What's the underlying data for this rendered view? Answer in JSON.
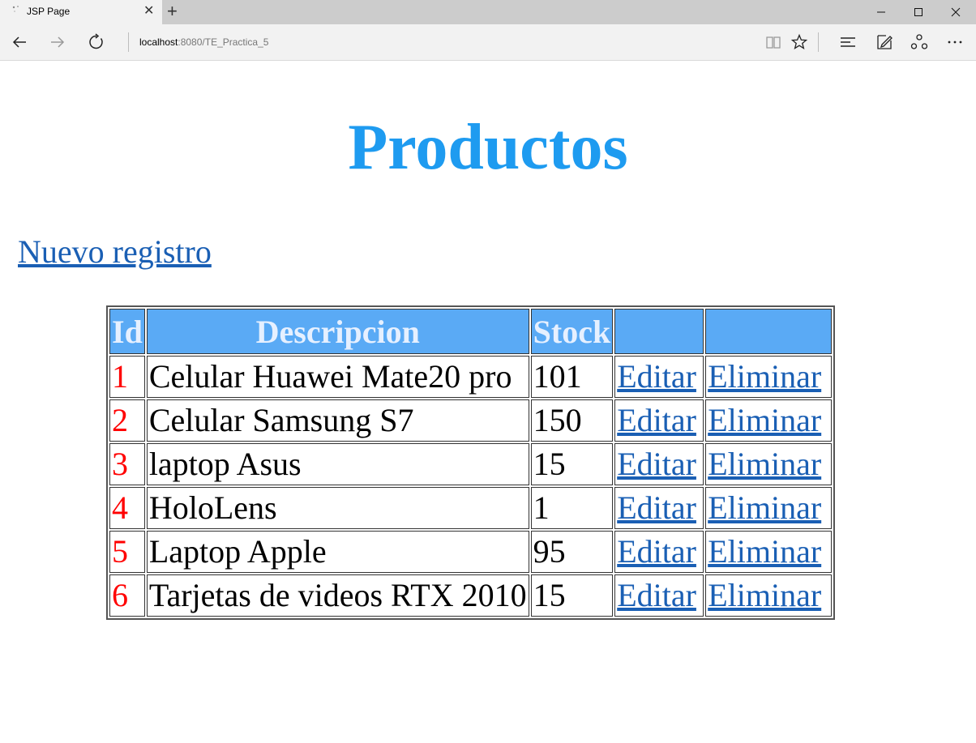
{
  "browser": {
    "tab_title": "JSP Page",
    "url_host": "localhost",
    "url_rest": ":8080/TE_Practica_5",
    "icons": {
      "back": "arrow-left-icon",
      "forward": "arrow-right-icon",
      "refresh": "refresh-icon",
      "reading_view": "book-icon",
      "favorite": "star-icon",
      "hub": "hub-lines-icon",
      "web_note": "pen-note-icon",
      "share": "share-icon",
      "more": "more-dots-icon"
    }
  },
  "page": {
    "title": "Productos",
    "new_link": "Nuevo registro",
    "table": {
      "headers": [
        "Id",
        "Descripcion",
        "Stock",
        "",
        ""
      ],
      "rows": [
        {
          "id": "1",
          "description": "Celular Huawei Mate20 pro",
          "stock": "101",
          "edit": "Editar",
          "delete": "Eliminar"
        },
        {
          "id": "2",
          "description": "Celular Samsung S7",
          "stock": "150",
          "edit": "Editar",
          "delete": "Eliminar"
        },
        {
          "id": "3",
          "description": "laptop Asus",
          "stock": "15",
          "edit": "Editar",
          "delete": "Eliminar"
        },
        {
          "id": "4",
          "description": "HoloLens",
          "stock": "1",
          "edit": "Editar",
          "delete": "Eliminar"
        },
        {
          "id": "5",
          "description": "Laptop Apple",
          "stock": "95",
          "edit": "Editar",
          "delete": "Eliminar"
        },
        {
          "id": "6",
          "description": "Tarjetas de videos RTX 2010",
          "stock": "15",
          "edit": "Editar",
          "delete": "Eliminar"
        }
      ]
    }
  },
  "colors": {
    "title": "#1e9bf0",
    "link": "#1a5fb4",
    "header_bg": "#5aaaf5",
    "header_text": "#e6f0ff",
    "id_text": "#ff0000"
  }
}
